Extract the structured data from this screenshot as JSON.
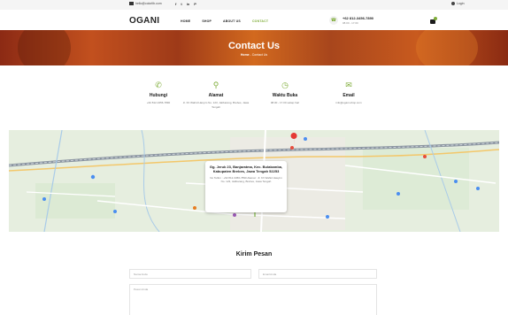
{
  "topbar": {
    "email": "hello@colorlib.com",
    "social": [
      "f",
      "t",
      "in",
      "P"
    ],
    "login": "Login"
  },
  "header": {
    "logo": "GANI",
    "logo_first": "O",
    "nav": [
      "HOME",
      "SHOP",
      "ABOUT US",
      "CONTACT"
    ],
    "phone": "+62 812-3456-7890",
    "phone_sub": "08.00 - 17.00"
  },
  "banner": {
    "title": "Contact Us",
    "crumb_home": "Home",
    "crumb_sep": "-",
    "crumb_current": "Contact Us"
  },
  "info": [
    {
      "icon": "phone-icon",
      "title": "Hubungi",
      "desc": "+62 812-3456-7890"
    },
    {
      "icon": "location-icon",
      "title": "Alamat",
      "desc": "Jl. Kh Wahid Hasyim No. 123, Jatibarang, Brebes, Jawa Tengah"
    },
    {
      "icon": "clock-icon",
      "title": "Waktu Buka",
      "desc": "08.00 - 17.00 setiap hari"
    },
    {
      "icon": "mail-icon",
      "title": "Email",
      "desc": "info@ogani-shop.com"
    }
  ],
  "map": {
    "card_address": "Gg. Jeruk 23, Banjaratma, Kec. Bulakamba, Kabupaten Brebes, Jawa Tengah 52253",
    "card_sub": "No Telfon : +62 812-3456-7890 Alamat : Jl. Kh Wahid Hasyim No. 123, Jatibarang, Brebes, Jawa Tengah"
  },
  "form": {
    "title": "Kirim Pesan",
    "name_placeholder": "Nama Anda",
    "email_placeholder": "Email Anda",
    "message_placeholder": "Pesan Anda"
  },
  "colors": {
    "accent": "#7fad39",
    "banner": "#c2501e"
  }
}
